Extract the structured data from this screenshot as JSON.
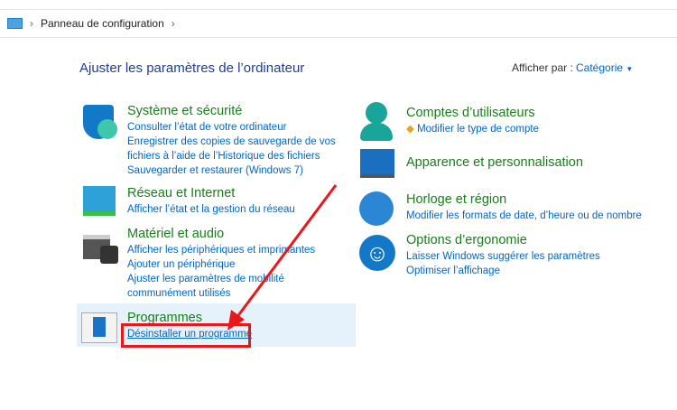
{
  "breadcrumb": {
    "root": "Panneau de configuration"
  },
  "title": "Ajuster les paramètres de l’ordinateur",
  "view": {
    "label": "Afficher par :",
    "value": "Catégorie"
  },
  "left": [
    {
      "title": "Système et sécurité",
      "links": [
        "Consulter l’état de votre ordinateur",
        "Enregistrer des copies de sauvegarde de vos fichiers à l’aide de l’Historique des fichiers",
        "Sauvegarder et restaurer (Windows 7)"
      ]
    },
    {
      "title": "Réseau et Internet",
      "links": [
        "Afficher l’état et la gestion du réseau"
      ]
    },
    {
      "title": "Matériel et audio",
      "links": [
        "Afficher les périphériques et imprimantes",
        "Ajouter un périphérique",
        "Ajuster les paramètres de mobilité communément utilisés"
      ]
    },
    {
      "title": "Programmes",
      "links": [
        "Désinstaller un programme"
      ]
    }
  ],
  "right": [
    {
      "title": "Comptes d’utilisateurs",
      "links": [
        "Modifier le type de compte"
      ]
    },
    {
      "title": "Apparence et personnalisation",
      "links": []
    },
    {
      "title": "Horloge et région",
      "links": [
        "Modifier les formats de date, d’heure ou de nombre"
      ]
    },
    {
      "title": "Options d’ergonomie",
      "links": [
        "Laisser Windows suggérer les paramètres",
        "Optimiser l’affichage"
      ]
    }
  ],
  "colors": {
    "annotation": "#e8181a",
    "link": "#0066cc",
    "heading": "#1a7d1a"
  }
}
